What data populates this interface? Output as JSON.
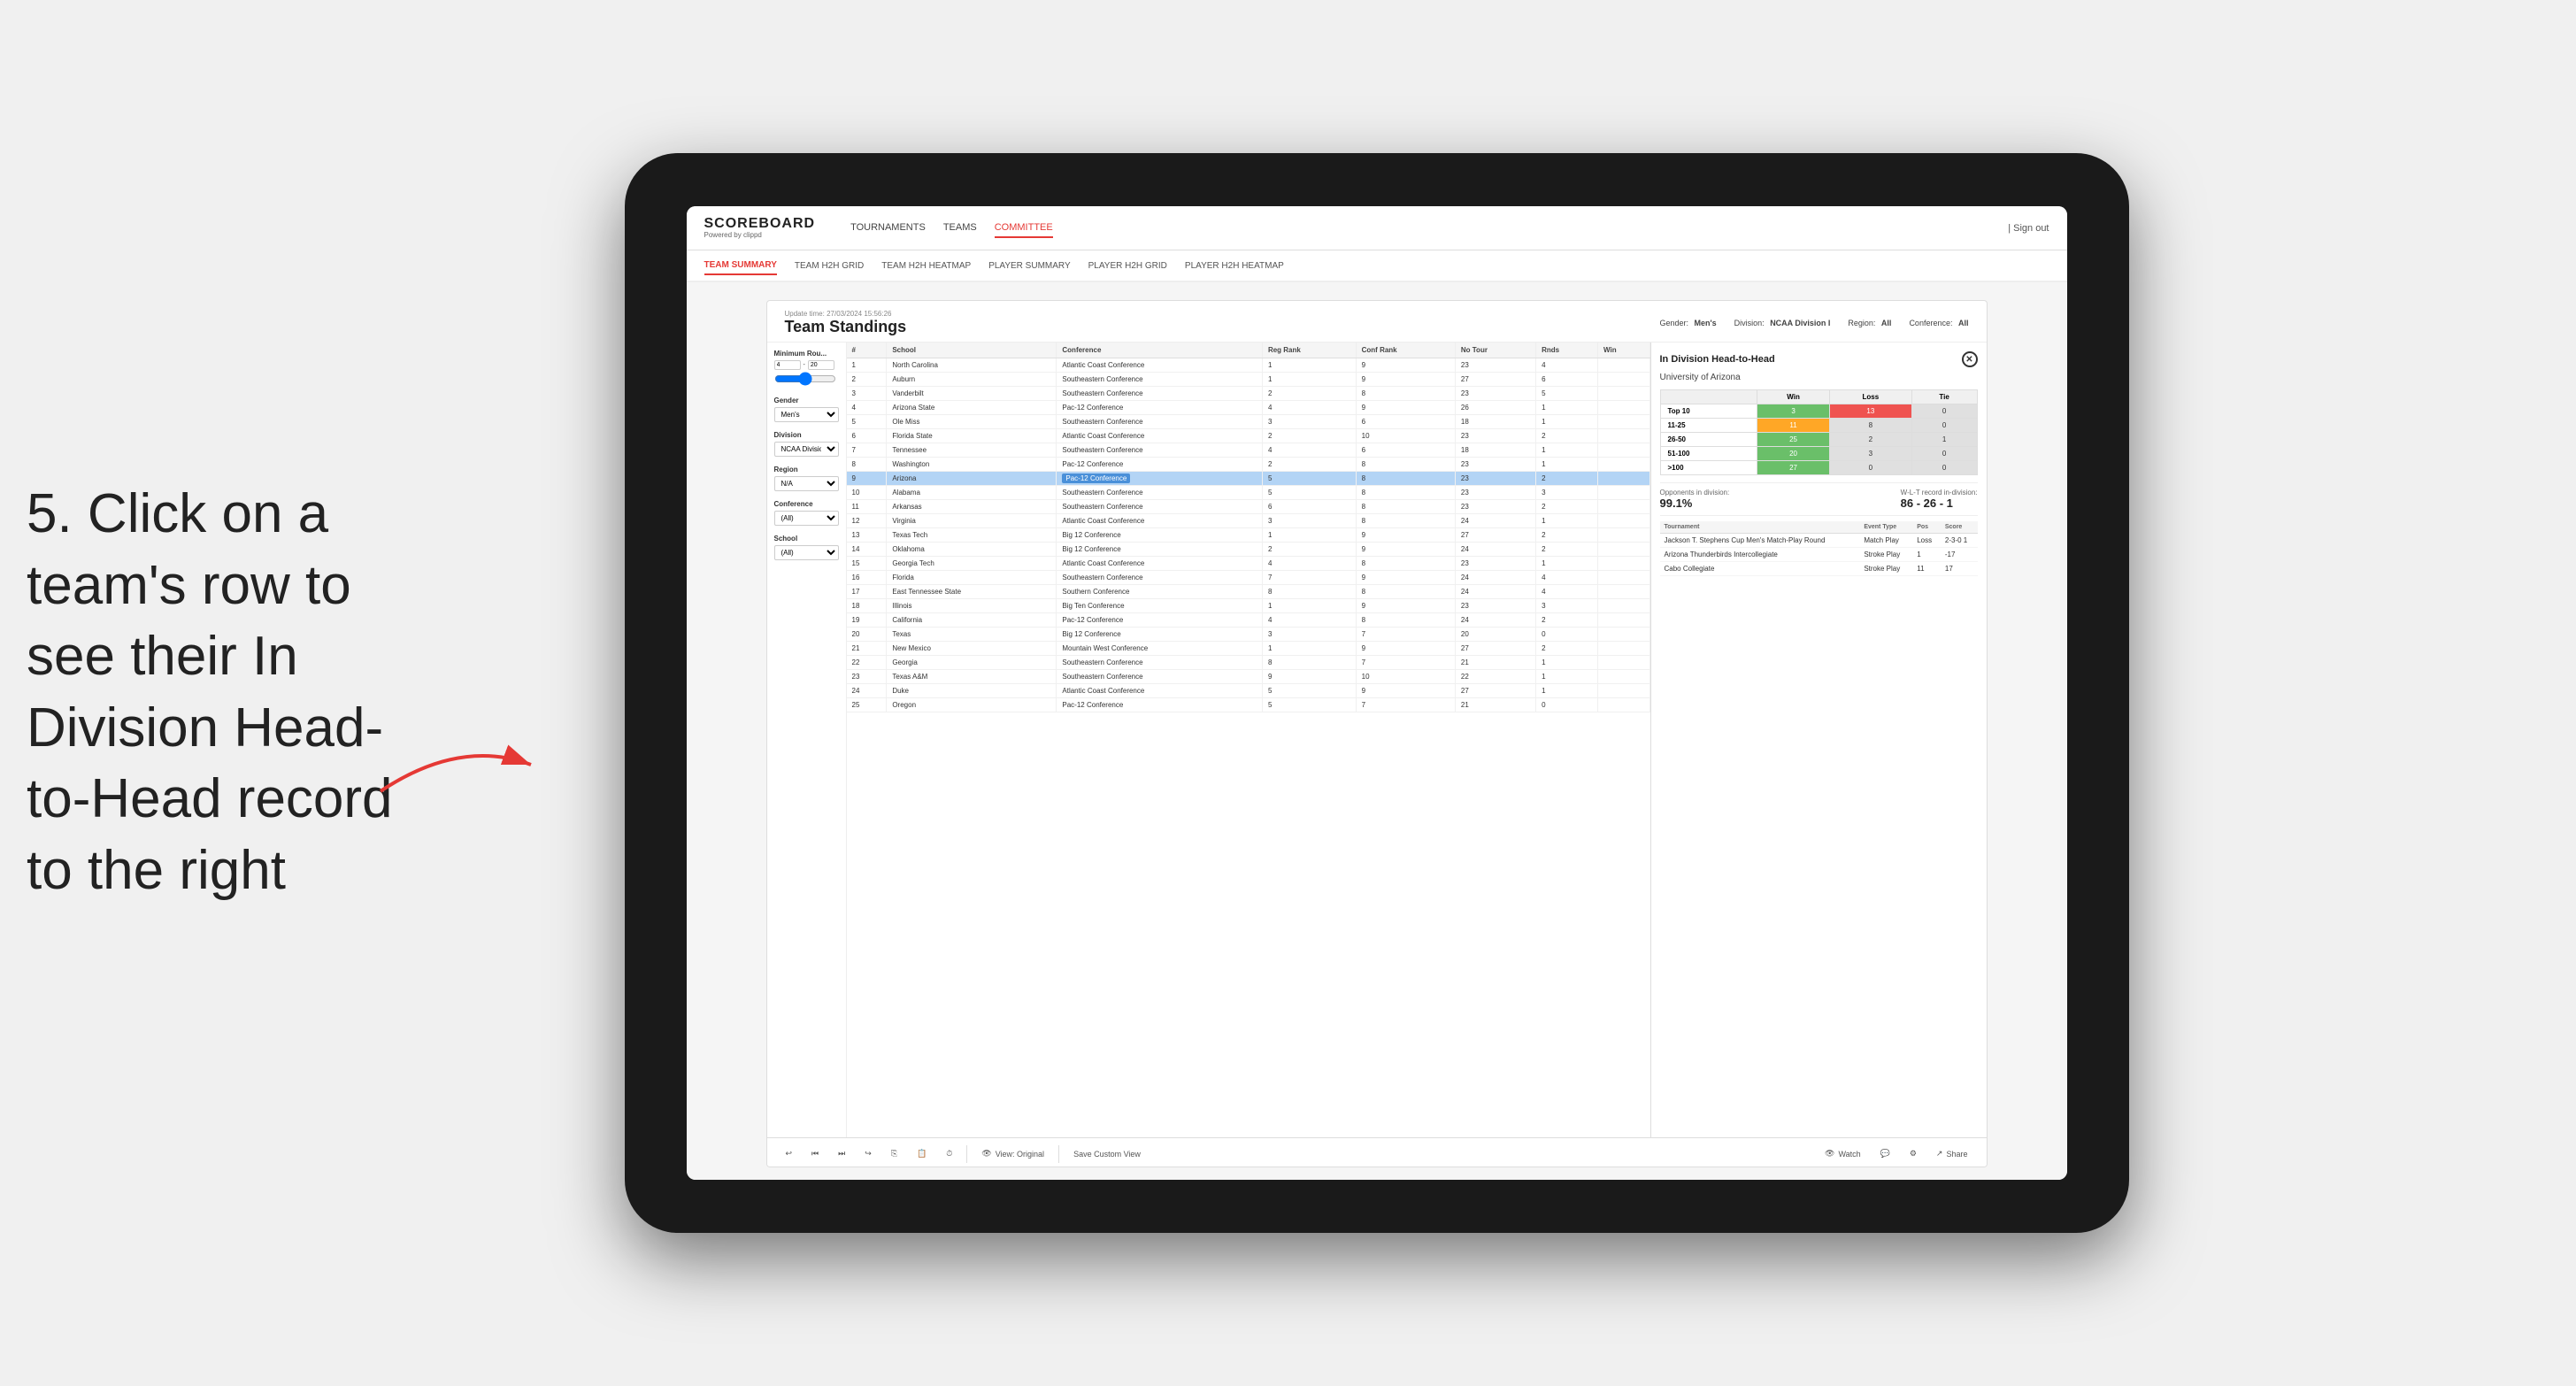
{
  "instruction": {
    "text": "5. Click on a team's row to see their In Division Head-to-Head record to the right"
  },
  "app": {
    "logo": "SCOREBOARD",
    "logo_sub": "Powered by clippd",
    "nav_links": [
      {
        "label": "TOURNAMENTS",
        "active": false
      },
      {
        "label": "TEAMS",
        "active": false
      },
      {
        "label": "COMMITTEE",
        "active": true
      }
    ],
    "sign_out": "Sign out",
    "sub_nav": [
      {
        "label": "TEAM SUMMARY",
        "active": true
      },
      {
        "label": "TEAM H2H GRID",
        "active": false
      },
      {
        "label": "TEAM H2H HEATMAP",
        "active": false
      },
      {
        "label": "PLAYER SUMMARY",
        "active": false
      },
      {
        "label": "PLAYER H2H GRID",
        "active": false
      },
      {
        "label": "PLAYER H2H HEATMAP",
        "active": false
      }
    ]
  },
  "content": {
    "update_time": "Update time: 27/03/2024 15:56:26",
    "title": "Team Standings",
    "gender_label": "Gender:",
    "gender_value": "Men's",
    "division_label": "Division:",
    "division_value": "NCAA Division I",
    "region_label": "Region:",
    "region_value": "All",
    "conference_label": "Conference:",
    "conference_value": "All"
  },
  "filters": {
    "min_rounds_label": "Minimum Rou...",
    "min_rounds_value": "4",
    "max_rounds_value": "20",
    "gender_label": "Gender",
    "gender_value": "Men's",
    "division_label": "Division",
    "division_value": "NCAA Division I",
    "region_label": "Region",
    "region_value": "N/A",
    "conference_label": "Conference",
    "conference_value": "(All)",
    "school_label": "School",
    "school_value": "(All)"
  },
  "table": {
    "headers": [
      "#",
      "School",
      "Conference",
      "Reg Rank",
      "Conf Rank",
      "No Tour",
      "Rnds",
      "Win"
    ],
    "rows": [
      {
        "rank": 1,
        "school": "North Carolina",
        "conference": "Atlantic Coast Conference",
        "reg_rank": 1,
        "conf_rank": 9,
        "no_tour": 23,
        "rnds": 4
      },
      {
        "rank": 2,
        "school": "Auburn",
        "conference": "Southeastern Conference",
        "reg_rank": 1,
        "conf_rank": 9,
        "no_tour": 27,
        "rnds": 6
      },
      {
        "rank": 3,
        "school": "Vanderbilt",
        "conference": "Southeastern Conference",
        "reg_rank": 2,
        "conf_rank": 8,
        "no_tour": 23,
        "rnds": 5
      },
      {
        "rank": 4,
        "school": "Arizona State",
        "conference": "Pac-12 Conference",
        "reg_rank": 4,
        "conf_rank": 9,
        "no_tour": 26,
        "rnds": 1
      },
      {
        "rank": 5,
        "school": "Ole Miss",
        "conference": "Southeastern Conference",
        "reg_rank": 3,
        "conf_rank": 6,
        "no_tour": 18,
        "rnds": 1
      },
      {
        "rank": 6,
        "school": "Florida State",
        "conference": "Atlantic Coast Conference",
        "reg_rank": 2,
        "conf_rank": 10,
        "no_tour": 23,
        "rnds": 2
      },
      {
        "rank": 7,
        "school": "Tennessee",
        "conference": "Southeastern Conference",
        "reg_rank": 4,
        "conf_rank": 6,
        "no_tour": 18,
        "rnds": 1
      },
      {
        "rank": 8,
        "school": "Washington",
        "conference": "Pac-12 Conference",
        "reg_rank": 2,
        "conf_rank": 8,
        "no_tour": 23,
        "rnds": 1
      },
      {
        "rank": 9,
        "school": "Arizona",
        "conference": "Pac-12 Conference",
        "reg_rank": 5,
        "conf_rank": 8,
        "no_tour": 23,
        "rnds": 2,
        "selected": true
      },
      {
        "rank": 10,
        "school": "Alabama",
        "conference": "Southeastern Conference",
        "reg_rank": 5,
        "conf_rank": 8,
        "no_tour": 23,
        "rnds": 3
      },
      {
        "rank": 11,
        "school": "Arkansas",
        "conference": "Southeastern Conference",
        "reg_rank": 6,
        "conf_rank": 8,
        "no_tour": 23,
        "rnds": 2
      },
      {
        "rank": 12,
        "school": "Virginia",
        "conference": "Atlantic Coast Conference",
        "reg_rank": 3,
        "conf_rank": 8,
        "no_tour": 24,
        "rnds": 1
      },
      {
        "rank": 13,
        "school": "Texas Tech",
        "conference": "Big 12 Conference",
        "reg_rank": 1,
        "conf_rank": 9,
        "no_tour": 27,
        "rnds": 2
      },
      {
        "rank": 14,
        "school": "Oklahoma",
        "conference": "Big 12 Conference",
        "reg_rank": 2,
        "conf_rank": 9,
        "no_tour": 24,
        "rnds": 2
      },
      {
        "rank": 15,
        "school": "Georgia Tech",
        "conference": "Atlantic Coast Conference",
        "reg_rank": 4,
        "conf_rank": 8,
        "no_tour": 23,
        "rnds": 1
      },
      {
        "rank": 16,
        "school": "Florida",
        "conference": "Southeastern Conference",
        "reg_rank": 7,
        "conf_rank": 9,
        "no_tour": 24,
        "rnds": 4
      },
      {
        "rank": 17,
        "school": "East Tennessee State",
        "conference": "Southern Conference",
        "reg_rank": 8,
        "conf_rank": 8,
        "no_tour": 24,
        "rnds": 4
      },
      {
        "rank": 18,
        "school": "Illinois",
        "conference": "Big Ten Conference",
        "reg_rank": 1,
        "conf_rank": 9,
        "no_tour": 23,
        "rnds": 3
      },
      {
        "rank": 19,
        "school": "California",
        "conference": "Pac-12 Conference",
        "reg_rank": 4,
        "conf_rank": 8,
        "no_tour": 24,
        "rnds": 2
      },
      {
        "rank": 20,
        "school": "Texas",
        "conference": "Big 12 Conference",
        "reg_rank": 3,
        "conf_rank": 7,
        "no_tour": 20,
        "rnds": 0
      },
      {
        "rank": 21,
        "school": "New Mexico",
        "conference": "Mountain West Conference",
        "reg_rank": 1,
        "conf_rank": 9,
        "no_tour": 27,
        "rnds": 2
      },
      {
        "rank": 22,
        "school": "Georgia",
        "conference": "Southeastern Conference",
        "reg_rank": 8,
        "conf_rank": 7,
        "no_tour": 21,
        "rnds": 1
      },
      {
        "rank": 23,
        "school": "Texas A&M",
        "conference": "Southeastern Conference",
        "reg_rank": 9,
        "conf_rank": 10,
        "no_tour": 22,
        "rnds": 1
      },
      {
        "rank": 24,
        "school": "Duke",
        "conference": "Atlantic Coast Conference",
        "reg_rank": 5,
        "conf_rank": 9,
        "no_tour": 27,
        "rnds": 1
      },
      {
        "rank": 25,
        "school": "Oregon",
        "conference": "Pac-12 Conference",
        "reg_rank": 5,
        "conf_rank": 7,
        "no_tour": 21,
        "rnds": 0
      }
    ]
  },
  "right_panel": {
    "title": "In Division Head-to-Head",
    "team": "University of Arizona",
    "h2h_headers": [
      "",
      "Win",
      "Loss",
      "Tie"
    ],
    "h2h_rows": [
      {
        "label": "Top 10",
        "win": 3,
        "loss": 13,
        "tie": 0,
        "win_color": "green",
        "loss_color": "red"
      },
      {
        "label": "11-25",
        "win": 11,
        "loss": 8,
        "tie": 0,
        "win_color": "orange",
        "loss_color": "grey"
      },
      {
        "label": "26-50",
        "win": 25,
        "loss": 2,
        "tie": 1,
        "win_color": "green",
        "loss_color": "grey"
      },
      {
        "label": "51-100",
        "win": 20,
        "loss": 3,
        "tie": 0,
        "win_color": "green",
        "loss_color": "grey"
      },
      {
        "label": ">100",
        "win": 27,
        "loss": 0,
        "tie": 0,
        "win_color": "green",
        "loss_color": "grey"
      }
    ],
    "opponents_label": "Opponents in division:",
    "opponents_value": "99.1%",
    "wlt_label": "W-L-T record in-division:",
    "wlt_value": "86 - 26 - 1",
    "tournament_headers": [
      "Tournament",
      "Event Type",
      "Pos",
      "Score"
    ],
    "tournament_rows": [
      {
        "tournament": "Jackson T. Stephens Cup Men's Match-Play Round",
        "event_type": "Match Play",
        "pos": "Loss",
        "score": "2-3-0 1"
      },
      {
        "tournament": "Arizona Thunderbirds Intercollegiate",
        "event_type": "Stroke Play",
        "pos": "1",
        "score": "-17"
      },
      {
        "tournament": "Cabo Collegiate",
        "event_type": "Stroke Play",
        "pos": "11",
        "score": "17"
      }
    ]
  },
  "toolbar": {
    "undo": "↩",
    "redo": "↪",
    "view_original": "View: Original",
    "save_custom": "Save Custom View",
    "watch": "Watch",
    "share": "Share"
  }
}
